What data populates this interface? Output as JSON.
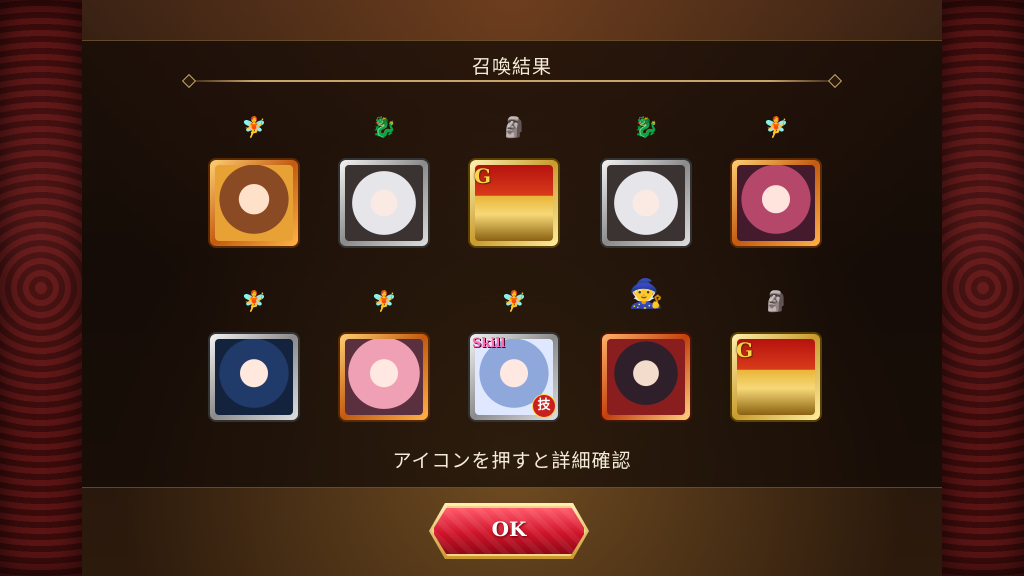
{
  "header": {
    "title": "召喚結果"
  },
  "results": [
    {
      "badge": "",
      "sprite_icon": "fairy-sprite-icon",
      "face": "brown",
      "frame": "bronze"
    },
    {
      "badge": "",
      "sprite_icon": "dragon-rider-sprite-icon",
      "face": "white",
      "frame": "silver"
    },
    {
      "badge": "G",
      "sprite_icon": "golem-sprite-icon",
      "face": "golem",
      "frame": "gold"
    },
    {
      "badge": "",
      "sprite_icon": "dragon-rider-sprite-icon",
      "face": "white",
      "frame": "silver"
    },
    {
      "badge": "",
      "sprite_icon": "fairy-sprite-icon",
      "face": "pink",
      "frame": "bronze"
    },
    {
      "badge": "",
      "sprite_icon": "fairy-sprite-icon",
      "face": "blue",
      "frame": "silver"
    },
    {
      "badge": "",
      "sprite_icon": "fairy-sprite-icon",
      "face": "rose",
      "frame": "bronze"
    },
    {
      "badge": "Skill",
      "corner_badge": "技",
      "sprite_icon": "fairy-sprite-icon",
      "face": "skyblue",
      "frame": "silver"
    },
    {
      "badge": "",
      "sprite_icon": "witch-sprite-icon",
      "face": "dark",
      "frame": "red"
    },
    {
      "badge": "G",
      "sprite_icon": "golem-sprite-icon",
      "face": "golem",
      "frame": "gold"
    }
  ],
  "hint_text": "アイコンを押すと詳細確認",
  "ok_button": {
    "label": "OK"
  }
}
